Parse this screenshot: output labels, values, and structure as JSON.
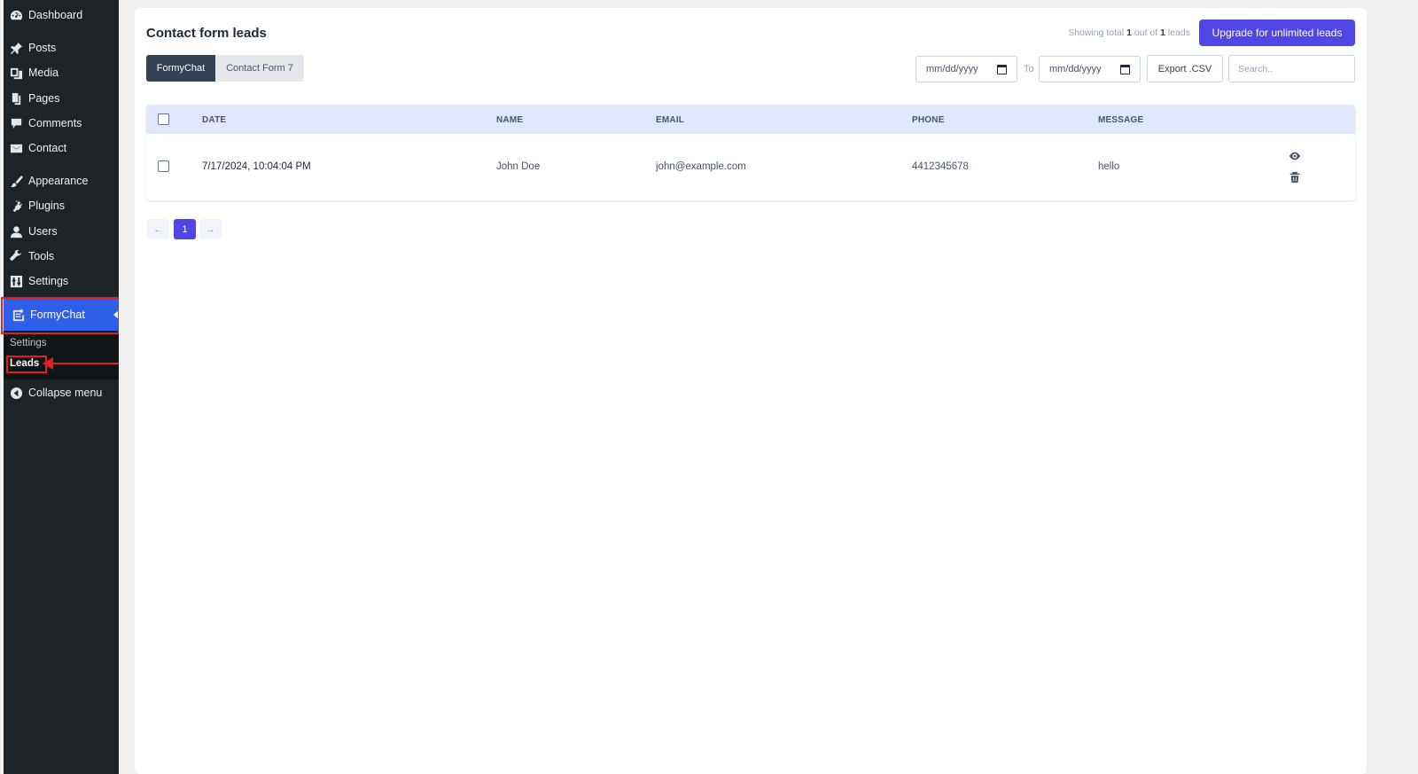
{
  "sidebar": {
    "items": [
      {
        "label": "Dashboard",
        "icon": "dashboard-icon"
      },
      {
        "label": "Posts",
        "icon": "pin-icon"
      },
      {
        "label": "Media",
        "icon": "media-icon"
      },
      {
        "label": "Pages",
        "icon": "pages-icon"
      },
      {
        "label": "Comments",
        "icon": "comment-icon"
      },
      {
        "label": "Contact",
        "icon": "mail-icon"
      },
      {
        "label": "Appearance",
        "icon": "brush-icon"
      },
      {
        "label": "Plugins",
        "icon": "plug-icon"
      },
      {
        "label": "Users",
        "icon": "user-icon"
      },
      {
        "label": "Tools",
        "icon": "wrench-icon"
      },
      {
        "label": "Settings",
        "icon": "settings-icon"
      },
      {
        "label": "FormyChat",
        "icon": "form-icon"
      }
    ],
    "submenu": {
      "settings": "Settings",
      "leads": "Leads"
    },
    "collapse": "Collapse menu"
  },
  "header": {
    "title": "Contact form leads",
    "showing_prefix": "Showing total",
    "showing_count": "1",
    "showing_mid": "out of",
    "showing_total": "1",
    "showing_suffix": "leads",
    "upgrade_label": "Upgrade for unlimited leads"
  },
  "tabs": [
    {
      "label": "FormyChat",
      "active": true
    },
    {
      "label": "Contact Form 7",
      "active": false
    }
  ],
  "filters": {
    "date_from_placeholder": "mm/dd/yyyy",
    "to_label": "To",
    "date_to_placeholder": "mm/dd/yyyy",
    "export_label": "Export .CSV",
    "search_placeholder": "Search.."
  },
  "table": {
    "columns": [
      "DATE",
      "NAME",
      "EMAIL",
      "PHONE",
      "MESSAGE"
    ],
    "rows": [
      {
        "date": "7/17/2024, 10:04:04 PM",
        "name": "John Doe",
        "email": "john@example.com",
        "phone": "4412345678",
        "message": "hello"
      }
    ]
  },
  "pagination": {
    "prev": "←",
    "current": "1",
    "next": "→"
  },
  "colors": {
    "accent": "#4f46e5",
    "sidebar_bg": "#1d2327",
    "active_menu": "#2f5fe9",
    "highlight": "#e01f1f"
  }
}
